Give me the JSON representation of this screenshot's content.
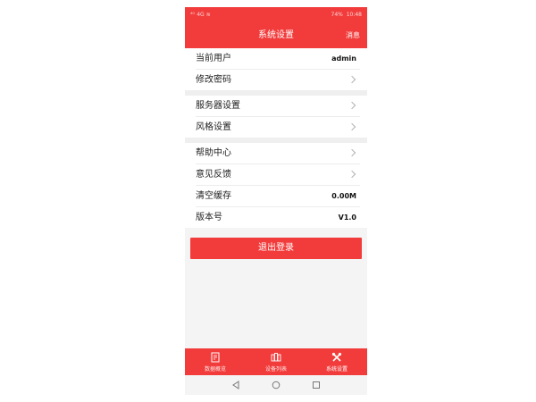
{
  "status": {
    "left": "⁴ᴳ 4G ≋",
    "battery": "74%",
    "time": "10:48"
  },
  "header": {
    "title": "系统设置",
    "message_label": "消息"
  },
  "settings": {
    "current_user_label": "当前用户",
    "current_user_value": "admin",
    "change_password_label": "修改密码",
    "server_settings_label": "服务器设置",
    "style_settings_label": "风格设置",
    "help_center_label": "帮助中心",
    "feedback_label": "意见反馈",
    "clear_cache_label": "清空缓存",
    "clear_cache_value": "0.00M",
    "version_label": "版本号",
    "version_value": "V1.0"
  },
  "logout_label": "退出登录",
  "tabs": [
    {
      "label": "数据概览",
      "icon": "document-chart-icon"
    },
    {
      "label": "设备列表",
      "icon": "device-list-icon"
    },
    {
      "label": "系统设置",
      "icon": "tools-icon"
    }
  ],
  "colors": {
    "brand": "#f23c3c",
    "background": "#f4f4f4"
  },
  "system_nav": [
    "back-icon",
    "home-icon",
    "recent-apps-icon"
  ]
}
